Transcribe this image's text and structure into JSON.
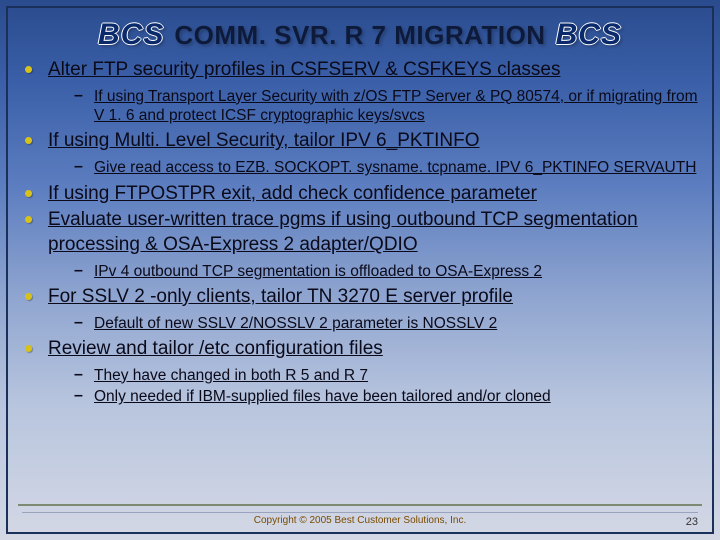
{
  "logo_text": "BCS",
  "title": "COMM. SVR. R 7 MIGRATION",
  "bullets": [
    {
      "text": "Alter FTP security profiles in CSFSERV & CSFKEYS classes",
      "subs": [
        "If using Transport Layer Security with z/OS FTP Server & PQ 80574, or if migrating from V 1. 6 and protect ICSF cryptographic keys/svcs"
      ]
    },
    {
      "text": "If using Multi. Level Security, tailor IPV 6_PKTINFO",
      "subs": [
        "Give read access to EZB. SOCKOPT. sysname. tcpname. IPV 6_PKTINFO SERVAUTH"
      ]
    },
    {
      "text": "If using FTPOSTPR exit, add check confidence parameter",
      "subs": []
    },
    {
      "text": "Evaluate user-written trace pgms if using outbound TCP segmentation processing & OSA-Express 2 adapter/QDIO",
      "subs": [
        "IPv 4 outbound TCP segmentation is offloaded to OSA-Express 2"
      ]
    },
    {
      "text": "For SSLV 2 -only clients, tailor TN 3270 E server profile",
      "subs": [
        "Default of new SSLV 2/NOSSLV 2 parameter is NOSSLV 2"
      ]
    },
    {
      "text": "Review and tailor /etc configuration files",
      "subs": [
        "They have changed in both R 5 and R 7",
        "Only needed if IBM-supplied files have been tailored and/or cloned"
      ]
    }
  ],
  "footer": "Copyright © 2005 Best Customer Solutions, Inc.",
  "page_number": "23"
}
